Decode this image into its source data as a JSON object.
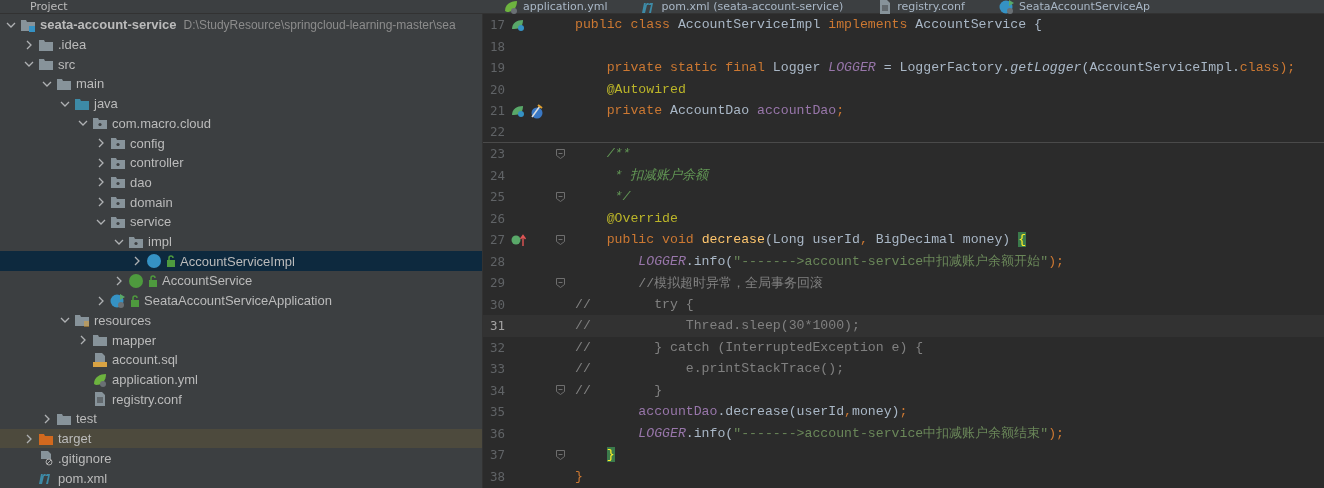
{
  "header": {
    "project_label": "Project",
    "tabs": [
      {
        "label": "application.yml",
        "kind": "yml",
        "selected": false
      },
      {
        "label": "pom.xml (seata-account-service)",
        "kind": "maven",
        "selected": false
      },
      {
        "label": "registry.conf",
        "kind": "text",
        "selected": false
      },
      {
        "label": "SeataAccountServiceAp",
        "kind": "boot",
        "selected": false
      }
    ]
  },
  "tree": [
    {
      "label": "seata-account-service",
      "kind": "module",
      "path": "D:\\StudyResource\\springcloud-learning-master\\sea",
      "expanded": true,
      "selected": false,
      "children": [
        {
          "label": ".idea",
          "kind": "folder",
          "expanded": false,
          "selected": false
        },
        {
          "label": "src",
          "kind": "folder",
          "expanded": true,
          "selected": false,
          "children": [
            {
              "label": "main",
              "kind": "folder",
              "expanded": true,
              "selected": false,
              "children": [
                {
                  "label": "java",
                  "kind": "source",
                  "expanded": true,
                  "selected": false,
                  "children": [
                    {
                      "label": "com.macro.cloud",
                      "kind": "package",
                      "expanded": true,
                      "selected": false,
                      "children": [
                        {
                          "label": "config",
                          "kind": "package",
                          "expanded": false,
                          "selected": false
                        },
                        {
                          "label": "controller",
                          "kind": "package",
                          "expanded": false,
                          "selected": false
                        },
                        {
                          "label": "dao",
                          "kind": "package",
                          "expanded": false,
                          "selected": false
                        },
                        {
                          "label": "domain",
                          "kind": "package",
                          "expanded": false,
                          "selected": false
                        },
                        {
                          "label": "service",
                          "kind": "package",
                          "expanded": true,
                          "selected": false,
                          "children": [
                            {
                              "label": "impl",
                              "kind": "package",
                              "expanded": true,
                              "selected": false,
                              "children": [
                                {
                                  "label": "AccountServiceImpl",
                                  "kind": "class",
                                  "expanded": false,
                                  "selected": true
                                }
                              ]
                            },
                            {
                              "label": "AccountService",
                              "kind": "interface",
                              "expanded": false,
                              "selected": false
                            }
                          ]
                        },
                        {
                          "label": "SeataAccountServiceApplication",
                          "kind": "boot",
                          "expanded": false,
                          "selected": false
                        }
                      ]
                    }
                  ]
                },
                {
                  "label": "resources",
                  "kind": "resources",
                  "expanded": true,
                  "selected": false,
                  "children": [
                    {
                      "label": "mapper",
                      "kind": "folder",
                      "expanded": false,
                      "selected": false
                    },
                    {
                      "label": "account.sql",
                      "kind": "sql",
                      "selected": false
                    },
                    {
                      "label": "application.yml",
                      "kind": "yml",
                      "selected": false
                    },
                    {
                      "label": "registry.conf",
                      "kind": "text",
                      "selected": false
                    }
                  ]
                }
              ]
            },
            {
              "label": "test",
              "kind": "folder",
              "expanded": false,
              "selected": false
            }
          ]
        },
        {
          "label": "target",
          "kind": "excluded",
          "expanded": false,
          "selected": false
        },
        {
          "label": ".gitignore",
          "kind": "ignore",
          "selected": false
        },
        {
          "label": "pom.xml",
          "kind": "maven",
          "selected": false
        }
      ]
    }
  ],
  "editor": {
    "lines": [
      {
        "number": "17",
        "gutter_icons": [
          {
            "kind": "bean"
          }
        ],
        "tokens": [
          {
            "t": "public class ",
            "kind": "kw"
          },
          {
            "t": "AccountServiceImpl",
            "kind": "plain"
          },
          {
            "t": " implements ",
            "kind": "kw"
          },
          {
            "t": "AccountService {",
            "kind": "plain"
          }
        ]
      },
      {
        "number": "18"
      },
      {
        "number": "19",
        "tokens": [
          {
            "t": "    private static final ",
            "kind": "kw"
          },
          {
            "t": "Logger ",
            "kind": "plain"
          },
          {
            "t": "LOGGER",
            "kind": "static"
          },
          {
            "t": " = LoggerFactory.",
            "kind": "plain"
          },
          {
            "t": "getLogger",
            "kind": "italic"
          },
          {
            "t": "(AccountServiceImpl.",
            "kind": "plain"
          },
          {
            "t": "class",
            "kind": "kw"
          },
          {
            "t": ");",
            "kind": "kw"
          }
        ]
      },
      {
        "number": "20",
        "tokens": [
          {
            "t": "    @Autowired",
            "kind": "annot"
          }
        ]
      },
      {
        "number": "21",
        "gutter_icons": [
          {
            "kind": "bean"
          },
          {
            "kind": "inject"
          }
        ],
        "tokens": [
          {
            "t": "    private ",
            "kind": "kw"
          },
          {
            "t": "AccountDao ",
            "kind": "plain"
          },
          {
            "t": "accountDao",
            "kind": "field"
          },
          {
            "t": ";",
            "kind": "kw"
          }
        ]
      },
      {
        "number": "22",
        "separator": true
      },
      {
        "number": "23",
        "fold": true,
        "tokens": [
          {
            "t": "    /**",
            "kind": "doc"
          }
        ]
      },
      {
        "number": "24",
        "tokens": [
          {
            "t": "     * 扣减账户余额",
            "kind": "doc"
          }
        ]
      },
      {
        "number": "25",
        "fold": true,
        "tokens": [
          {
            "t": "     */",
            "kind": "doc"
          }
        ]
      },
      {
        "number": "26",
        "tokens": [
          {
            "t": "    @Override",
            "kind": "annot"
          }
        ]
      },
      {
        "number": "27",
        "gutter_icons": [
          {
            "kind": "override"
          }
        ],
        "fold": true,
        "tokens": [
          {
            "t": "    public void ",
            "kind": "kw"
          },
          {
            "t": "decrease",
            "kind": "method"
          },
          {
            "t": "(Long userId",
            "kind": "plain"
          },
          {
            "t": ", ",
            "kind": "kw"
          },
          {
            "t": "BigDecimal money) ",
            "kind": "plain"
          },
          {
            "t": "{",
            "kind": "brace"
          }
        ]
      },
      {
        "number": "28",
        "tokens": [
          {
            "t": "        LOGGER",
            "kind": "static"
          },
          {
            "t": ".info(",
            "kind": "plain"
          },
          {
            "t": "\"------->account-service中扣减账户余额开始\"",
            "kind": "string"
          },
          {
            "t": ");",
            "kind": "kw"
          }
        ]
      },
      {
        "number": "29",
        "fold": true,
        "tokens": [
          {
            "t": "        //模拟超时异常，全局事务回滚",
            "kind": "comment"
          }
        ]
      },
      {
        "number": "30",
        "tokens": [
          {
            "t": "//        try {",
            "kind": "comment"
          }
        ]
      },
      {
        "number": "31",
        "current": true,
        "tokens": [
          {
            "t": "//            Thread.sleep(30*1000);",
            "kind": "comment"
          }
        ]
      },
      {
        "number": "32",
        "tokens": [
          {
            "t": "//        } catch (InterruptedException e) {",
            "kind": "comment"
          }
        ]
      },
      {
        "number": "33",
        "tokens": [
          {
            "t": "//            e.printStackTrace();",
            "kind": "comment"
          }
        ]
      },
      {
        "number": "34",
        "fold": true,
        "tokens": [
          {
            "t": "//        }",
            "kind": "comment"
          }
        ]
      },
      {
        "number": "35",
        "tokens": [
          {
            "t": "        accountDao",
            "kind": "field"
          },
          {
            "t": ".decrease(userId",
            "kind": "plain"
          },
          {
            "t": ",",
            "kind": "kw"
          },
          {
            "t": "money)",
            "kind": "plain"
          },
          {
            "t": ";",
            "kind": "kw"
          }
        ]
      },
      {
        "number": "36",
        "tokens": [
          {
            "t": "        LOGGER",
            "kind": "static"
          },
          {
            "t": ".info(",
            "kind": "plain"
          },
          {
            "t": "\"------->account-service中扣减账户余额结束\"",
            "kind": "string"
          },
          {
            "t": ");",
            "kind": "kw"
          }
        ]
      },
      {
        "number": "37",
        "fold": true,
        "tokens": [
          {
            "t": "    }",
            "kind": "brace"
          }
        ]
      },
      {
        "number": "38",
        "tokens": [
          {
            "t": "}",
            "kind": "kw"
          }
        ]
      }
    ]
  }
}
